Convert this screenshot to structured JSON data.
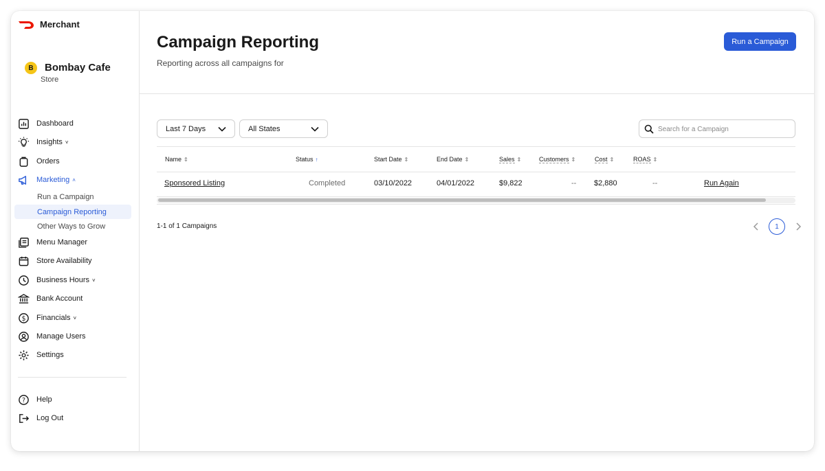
{
  "brand": {
    "name": "Merchant",
    "logo": "doordash-logo",
    "color": "#eb1700"
  },
  "store": {
    "initial": "B",
    "name": "Bombay Cafe",
    "type": "Store"
  },
  "nav": {
    "dashboard": "Dashboard",
    "insights": "Insights",
    "orders": "Orders",
    "marketing": "Marketing",
    "marketing_sub": [
      "Run a Campaign",
      "Campaign Reporting",
      "Other Ways to Grow"
    ],
    "menu_manager": "Menu Manager",
    "store_availability": "Store Availability",
    "business_hours": "Business Hours",
    "bank_account": "Bank Account",
    "financials": "Financials",
    "manage_users": "Manage Users",
    "settings": "Settings",
    "help": "Help",
    "log_out": "Log Out",
    "chevron_down": "˅",
    "chevron_up": "˄"
  },
  "page": {
    "title": "Campaign Reporting",
    "subtitle": "Reporting across all campaigns for",
    "primary_button": "Run a Campaign"
  },
  "filters": {
    "date_range": "Last 7 Days",
    "state": "All States",
    "search_placeholder": "Search for a Campaign"
  },
  "table": {
    "headers": {
      "name": "Name",
      "status": "Status",
      "start_date": "Start Date",
      "end_date": "End Date",
      "sales": "Sales",
      "customers": "Customers",
      "cost": "Cost",
      "roas": "ROAS"
    },
    "sort_icon": "⇕",
    "sort_asc_icon": "↑",
    "rows": [
      {
        "name": "Sponsored Listing",
        "status": "Completed",
        "start_date": "03/10/2022",
        "end_date": "04/01/2022",
        "sales": "$9,822",
        "customers": "--",
        "cost": "$2,880",
        "roas": "--",
        "action": "Run Again"
      }
    ]
  },
  "pagination": {
    "summary": "1-1 of 1 Campaigns",
    "current_page": "1"
  },
  "colors": {
    "accent": "#2a5bd7",
    "text": "#191919",
    "muted": "#6b6b6b"
  }
}
